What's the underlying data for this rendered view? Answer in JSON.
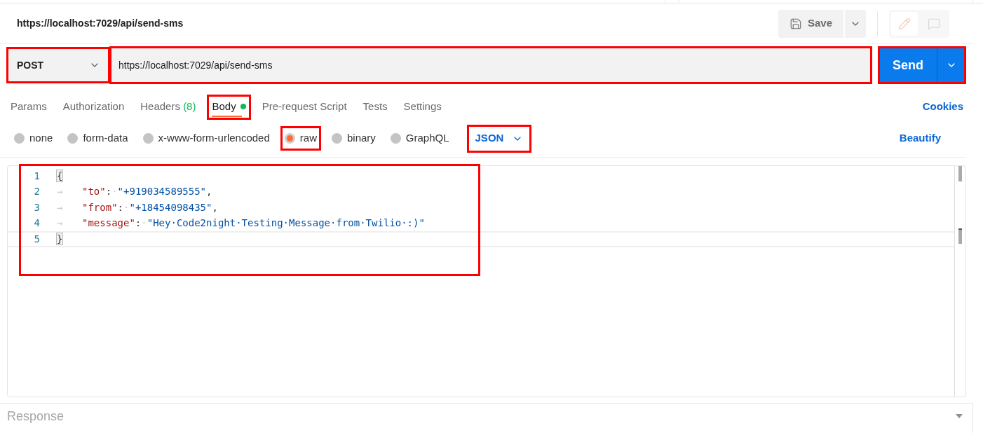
{
  "header": {
    "title": "https://localhost:7029/api/send-sms",
    "save_label": "Save"
  },
  "request": {
    "method": "POST",
    "method_highlighted": true,
    "url": "https://localhost:7029/api/send-sms",
    "url_highlighted": true,
    "send_label": "Send",
    "send_highlighted": true
  },
  "tabs": [
    {
      "label": "Params",
      "selected": false,
      "has_content": false,
      "highlighted": false
    },
    {
      "label": "Authorization",
      "selected": false,
      "has_content": false,
      "highlighted": false
    },
    {
      "label": "Headers",
      "count": "(8)",
      "selected": false,
      "has_content": false,
      "highlighted": false
    },
    {
      "label": "Body",
      "selected": true,
      "has_content": true,
      "highlighted": true
    },
    {
      "label": "Pre-request Script",
      "selected": false,
      "has_content": false,
      "highlighted": false
    },
    {
      "label": "Tests",
      "selected": false,
      "has_content": false,
      "highlighted": false
    },
    {
      "label": "Settings",
      "selected": false,
      "has_content": false,
      "highlighted": false
    }
  ],
  "cookies_link": "Cookies",
  "body_types": [
    {
      "label": "none",
      "selected": false,
      "highlighted": false
    },
    {
      "label": "form-data",
      "selected": false,
      "highlighted": false
    },
    {
      "label": "x-www-form-urlencoded",
      "selected": false,
      "highlighted": false
    },
    {
      "label": "raw",
      "selected": true,
      "highlighted": true
    },
    {
      "label": "binary",
      "selected": false,
      "highlighted": false
    },
    {
      "label": "GraphQL",
      "selected": false,
      "highlighted": false
    }
  ],
  "format": {
    "label": "JSON",
    "highlighted": true
  },
  "beautify_link": "Beautify",
  "editor": {
    "highlighted": true,
    "lines": [
      {
        "number": "1",
        "tokens": [
          {
            "kind": "bracket",
            "text": "{"
          }
        ]
      },
      {
        "number": "2",
        "tokens": [
          {
            "kind": "tab",
            "text": "→"
          },
          {
            "kind": "key",
            "text": "\"to\""
          },
          {
            "kind": "punct",
            "text": ":"
          },
          {
            "kind": "space",
            "text": "·"
          },
          {
            "kind": "string",
            "text": "\"+919034589555\""
          },
          {
            "kind": "punct",
            "text": ","
          }
        ]
      },
      {
        "number": "3",
        "tokens": [
          {
            "kind": "tab",
            "text": "→"
          },
          {
            "kind": "key",
            "text": "\"from\""
          },
          {
            "kind": "punct",
            "text": ":"
          },
          {
            "kind": "space",
            "text": "·"
          },
          {
            "kind": "string",
            "text": "\"+18454098435\""
          },
          {
            "kind": "punct",
            "text": ","
          }
        ]
      },
      {
        "number": "4",
        "tokens": [
          {
            "kind": "tab",
            "text": "→"
          },
          {
            "kind": "key",
            "text": "\"message\""
          },
          {
            "kind": "punct",
            "text": ":"
          },
          {
            "kind": "space",
            "text": "·"
          },
          {
            "kind": "string",
            "text": "\"Hey·Code2night·Testing·Message·from·Twilio·:)\""
          }
        ]
      },
      {
        "number": "5",
        "tokens": [
          {
            "kind": "bracket",
            "text": "}"
          }
        ]
      }
    ]
  },
  "response": {
    "label": "Response"
  }
}
